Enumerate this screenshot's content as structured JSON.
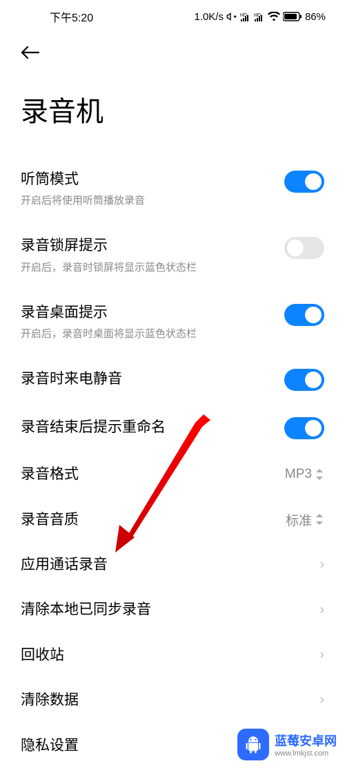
{
  "status": {
    "time": "下午5:20",
    "speed": "1.0K/s",
    "battery": "86%"
  },
  "page": {
    "title": "录音机"
  },
  "settings": {
    "earpiece": {
      "title": "听筒模式",
      "desc": "开启后将使用听筒播放录音",
      "on": true
    },
    "lockscreen": {
      "title": "录音锁屏提示",
      "desc": "开启后，录音时锁屏将显示蓝色状态栏",
      "on": false
    },
    "desktop": {
      "title": "录音桌面提示",
      "desc": "开启后，录音时桌面将显示蓝色状态栏",
      "on": true
    },
    "mute_incoming": {
      "title": "录音时来电静音",
      "on": true
    },
    "rename_prompt": {
      "title": "录音结束后提示重命名",
      "on": true
    },
    "format": {
      "title": "录音格式",
      "value": "MP3"
    },
    "quality": {
      "title": "录音音质",
      "value": "标准"
    },
    "app_call_recording": {
      "title": "应用通话录音"
    },
    "clear_synced": {
      "title": "清除本地已同步录音"
    },
    "recycle_bin": {
      "title": "回收站"
    },
    "clear_data": {
      "title": "清除数据"
    },
    "privacy": {
      "title": "隐私设置"
    }
  },
  "watermark": {
    "title": "蓝莓安卓网",
    "url": "www.lmkjst.com"
  }
}
